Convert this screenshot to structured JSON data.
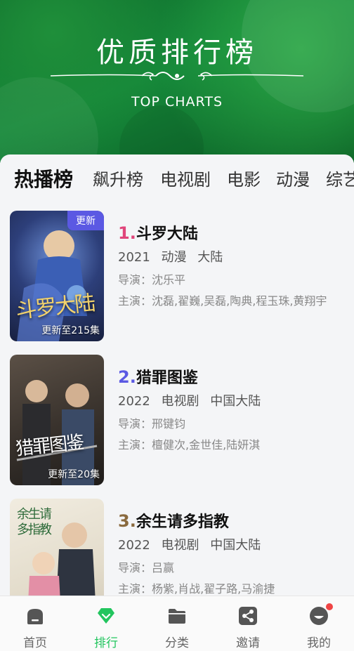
{
  "hero": {
    "title": "优质排行榜",
    "subtitle": "TOP CHARTS"
  },
  "tabs": [
    {
      "label": "热播榜",
      "active": true
    },
    {
      "label": "飙升榜",
      "active": false
    },
    {
      "label": "电视剧",
      "active": false
    },
    {
      "label": "电影",
      "active": false
    },
    {
      "label": "动漫",
      "active": false
    },
    {
      "label": "综艺",
      "active": false
    }
  ],
  "items": [
    {
      "rank": "1.",
      "rank_color": "#e0457b",
      "title": "斗罗大陆",
      "year": "2021",
      "genre": "动漫",
      "region": "大陆",
      "director": "导演：沈乐平",
      "cast": "主演：沈磊,翟巍,吴磊,陶典,程玉珠,黄翔宇",
      "badge": "更新",
      "episode": "更新至215集",
      "poster_title": "斗罗大陆"
    },
    {
      "rank": "2.",
      "rank_color": "#5b59e3",
      "title": "猎罪图鉴",
      "year": "2022",
      "genre": "电视剧",
      "region": "中国大陆",
      "director": "导演：邢键钧",
      "cast": "主演：檀健次,金世佳,陆妍淇",
      "episode": "更新至20集",
      "poster_title": "猎罪图鉴"
    },
    {
      "rank": "3.",
      "rank_color": "#8a6a3e",
      "title": "余生请多指教",
      "year": "2022",
      "genre": "电视剧",
      "region": "中国大陆",
      "director": "导演：吕赢",
      "cast": "主演：杨紫,肖战,翟子路,马渝捷",
      "poster_title": "余生请多指教"
    }
  ],
  "nav": [
    {
      "label": "首页",
      "icon": "home-icon",
      "active": false
    },
    {
      "label": "排行",
      "icon": "diamond-icon",
      "active": true
    },
    {
      "label": "分类",
      "icon": "folder-icon",
      "active": false
    },
    {
      "label": "邀请",
      "icon": "share-icon",
      "active": false
    },
    {
      "label": "我的",
      "icon": "profile-icon",
      "active": false,
      "dot": true
    }
  ],
  "colors": {
    "accent": "#22c55e",
    "badge": "#5b59e3",
    "nav_inactive": "#666666"
  }
}
